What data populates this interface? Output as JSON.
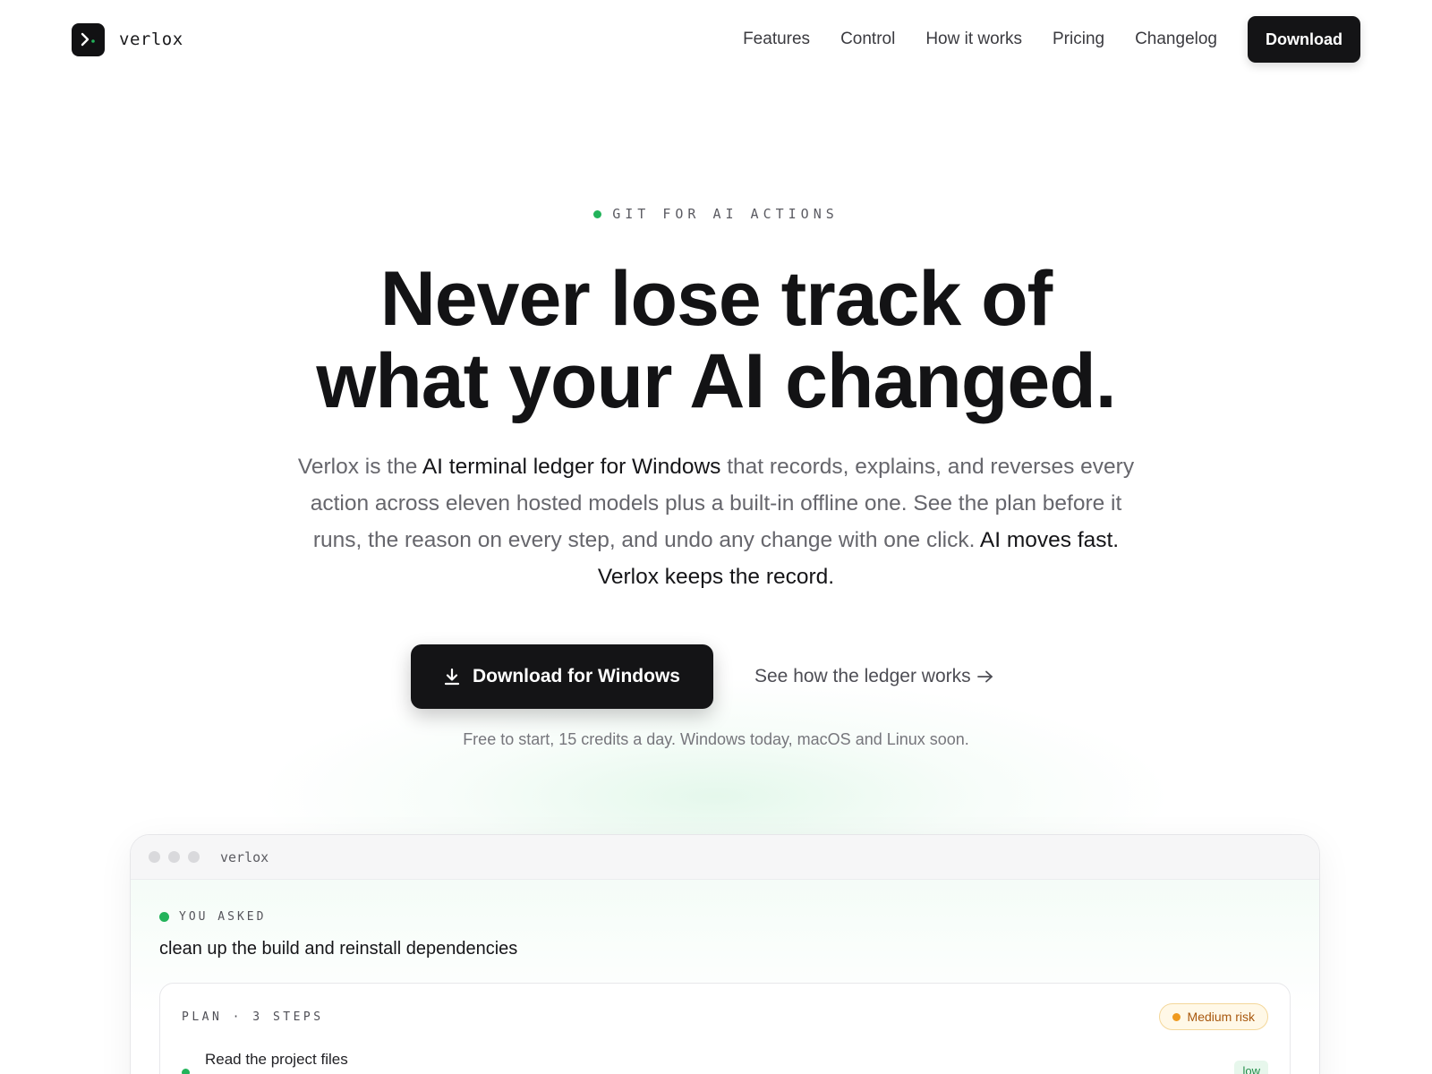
{
  "brand": {
    "name": "verlox",
    "logo_icon": "terminal-prompt-icon"
  },
  "nav": {
    "links": [
      "Features",
      "Control",
      "How it works",
      "Pricing",
      "Changelog"
    ],
    "download_label": "Download"
  },
  "hero": {
    "eyebrow": "GIT FOR AI ACTIONS",
    "headline_line1": "Never lose track of",
    "headline_line2": "what your AI changed.",
    "sub_part1": "Verlox is the ",
    "sub_strong1": "AI terminal ledger for Windows",
    "sub_part2": " that records, explains, and reverses every action across eleven hosted models plus a built-in offline one. See the plan before it runs, the reason on every step, and undo any change with one click. ",
    "sub_strong2": "AI moves fast. Verlox keeps the record.",
    "cta_primary": "Download for Windows",
    "cta_primary_icon": "download-icon",
    "cta_secondary": "See how the ledger works",
    "cta_secondary_icon": "arrow-right-icon",
    "fine_print": "Free to start, 15 credits a day. Windows today, macOS and Linux soon."
  },
  "window": {
    "title": "verlox",
    "asked_label": "YOU ASKED",
    "asked_query": "clean up the build and reinstall dependencies",
    "plan": {
      "label": "PLAN · 3 STEPS",
      "risk": "Medium risk",
      "steps": [
        {
          "text": "Read the project files",
          "tag": "low"
        }
      ]
    }
  },
  "colors": {
    "accent_green": "#22b35a",
    "primary_dark": "#141416",
    "risk_amber": "#ef9a1f"
  }
}
